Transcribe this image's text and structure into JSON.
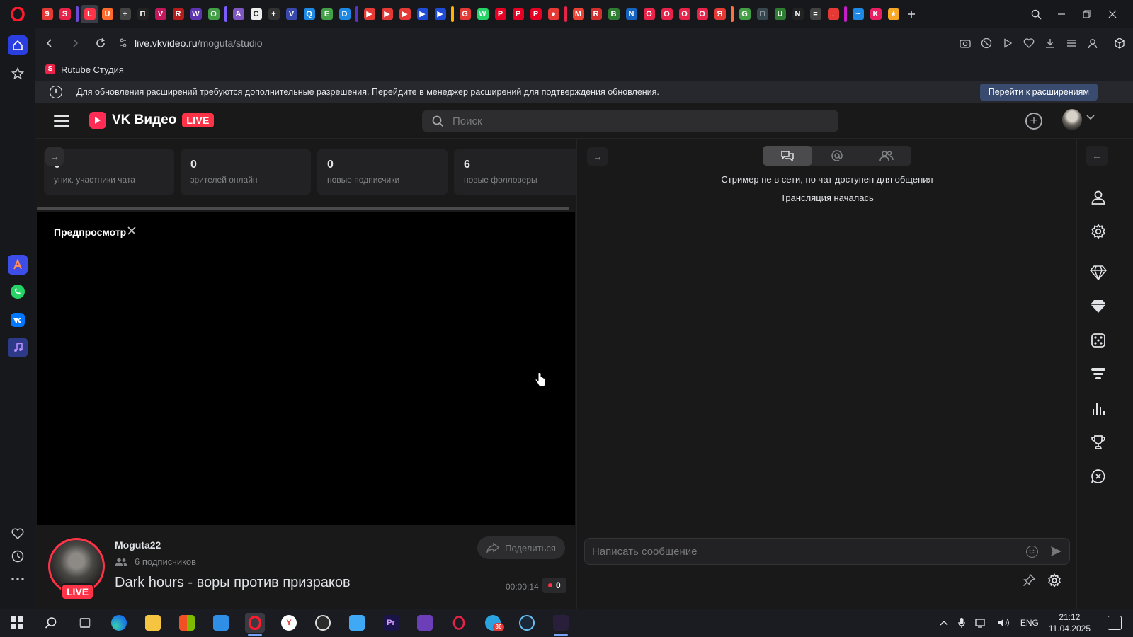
{
  "browser": {
    "tabs": [
      {
        "name": "tab-1",
        "color": "#e53935",
        "letter": "9"
      },
      {
        "name": "tab-rutube",
        "color": "#e8234a",
        "letter": "S"
      },
      {
        "name": "tab-vk-live",
        "color": "#ff3347",
        "letter": "L",
        "active": true
      },
      {
        "name": "tab-4",
        "color": "#ff6b2c",
        "letter": "U"
      },
      {
        "name": "tab-5",
        "color": "#444",
        "letter": "+"
      },
      {
        "name": "tab-6",
        "color": "#222",
        "letter": "П"
      },
      {
        "name": "tab-7",
        "color": "#c2185b",
        "letter": "V"
      },
      {
        "name": "tab-8",
        "color": "#b71c1c",
        "letter": "R"
      },
      {
        "name": "tab-9",
        "color": "#5e35b1",
        "letter": "W"
      },
      {
        "name": "tab-10",
        "color": "#43a047",
        "letter": "O"
      },
      {
        "name": "tab-11",
        "color": "#7e57c2",
        "letter": "A"
      },
      {
        "name": "tab-12",
        "color": "#eeeeee",
        "letter": "C"
      },
      {
        "name": "tab-13",
        "color": "#333",
        "letter": "+"
      },
      {
        "name": "tab-14",
        "color": "#3949ab",
        "letter": "V"
      },
      {
        "name": "tab-15",
        "color": "#1e88e5",
        "letter": "Q"
      },
      {
        "name": "tab-16",
        "color": "#43a047",
        "letter": "E"
      },
      {
        "name": "tab-17",
        "color": "#1e88e5",
        "letter": "D"
      },
      {
        "name": "tab-18",
        "color": "#e53935",
        "letter": "▶"
      },
      {
        "name": "tab-19",
        "color": "#e53935",
        "letter": "▶"
      },
      {
        "name": "tab-20",
        "color": "#e53935",
        "letter": "▶"
      },
      {
        "name": "tab-21",
        "color": "#1e4bd8",
        "letter": "▶"
      },
      {
        "name": "tab-22",
        "color": "#1e4bd8",
        "letter": "▶"
      },
      {
        "name": "tab-23",
        "color": "#e53935",
        "letter": "G"
      },
      {
        "name": "tab-24",
        "color": "#25d366",
        "letter": "W"
      },
      {
        "name": "tab-25",
        "color": "#e60023",
        "letter": "P"
      },
      {
        "name": "tab-26",
        "color": "#e60023",
        "letter": "P"
      },
      {
        "name": "tab-27",
        "color": "#e60023",
        "letter": "P"
      },
      {
        "name": "tab-28",
        "color": "#e53935",
        "letter": "●"
      },
      {
        "name": "tab-29",
        "color": "#ea4335",
        "letter": "M"
      },
      {
        "name": "tab-30",
        "color": "#d32f2f",
        "letter": "R"
      },
      {
        "name": "tab-31",
        "color": "#2e7d32",
        "letter": "B"
      },
      {
        "name": "tab-32",
        "color": "#1565c0",
        "letter": "N"
      },
      {
        "name": "tab-33",
        "color": "#e8234a",
        "letter": "O"
      },
      {
        "name": "tab-34",
        "color": "#e8234a",
        "letter": "O"
      },
      {
        "name": "tab-35",
        "color": "#e8234a",
        "letter": "O"
      },
      {
        "name": "tab-36",
        "color": "#e8234a",
        "letter": "O"
      },
      {
        "name": "tab-37",
        "color": "#e53935",
        "letter": "Я"
      },
      {
        "name": "tab-38",
        "color": "#43a047",
        "letter": "G"
      },
      {
        "name": "tab-39",
        "color": "#37474f",
        "letter": "□"
      },
      {
        "name": "tab-40",
        "color": "#2e7d32",
        "letter": "U"
      },
      {
        "name": "tab-41",
        "color": "#222",
        "letter": "N"
      },
      {
        "name": "tab-42",
        "color": "#444",
        "letter": "="
      },
      {
        "name": "tab-43",
        "color": "#e53935",
        "letter": "↓"
      },
      {
        "name": "tab-44",
        "color": "#1e88e5",
        "letter": "~"
      },
      {
        "name": "tab-45",
        "color": "#e91e63",
        "letter": "K"
      },
      {
        "name": "tab-46",
        "color": "#f9a825",
        "letter": "★"
      }
    ],
    "address": {
      "url_domain": "live.vkvideo.ru",
      "url_path": "/moguta/studio"
    },
    "bookmark": {
      "label": "Rutube Студия",
      "icon_letter": "S"
    },
    "notice": {
      "text": "Для обновления расширений требуются дополнительные разрешения. Перейдите в менеджер расширений для подтверждения обновления.",
      "button": "Перейти к расширениям"
    }
  },
  "vk": {
    "logo_text": "VK Видео",
    "live_badge": "LIVE",
    "search_placeholder": "Поиск",
    "stats": [
      {
        "value": "0",
        "label": "уник. участники чата"
      },
      {
        "value": "0",
        "label": "зрителей онлайн"
      },
      {
        "value": "0",
        "label": "новые подписчики"
      },
      {
        "value": "6",
        "label": "новые фолловеры"
      }
    ],
    "preview_title": "Предпросмотр",
    "channel": {
      "name": "Moguta22",
      "subscribers": "6 подписчиков",
      "live_tag": "LIVE",
      "stream_title": "Dark hours - воры против призраков",
      "share": "Поделиться",
      "timer": "00:00:14",
      "viewers": "0"
    },
    "chat": {
      "message_1": "Стример не в сети, но чат доступен для общения",
      "message_2": "Трансляция началась",
      "input_placeholder": "Написать сообщение"
    }
  },
  "taskbar": {
    "lang": "ENG",
    "time": "21:12",
    "date": "11.04.2025",
    "telegram_badge": "86"
  }
}
